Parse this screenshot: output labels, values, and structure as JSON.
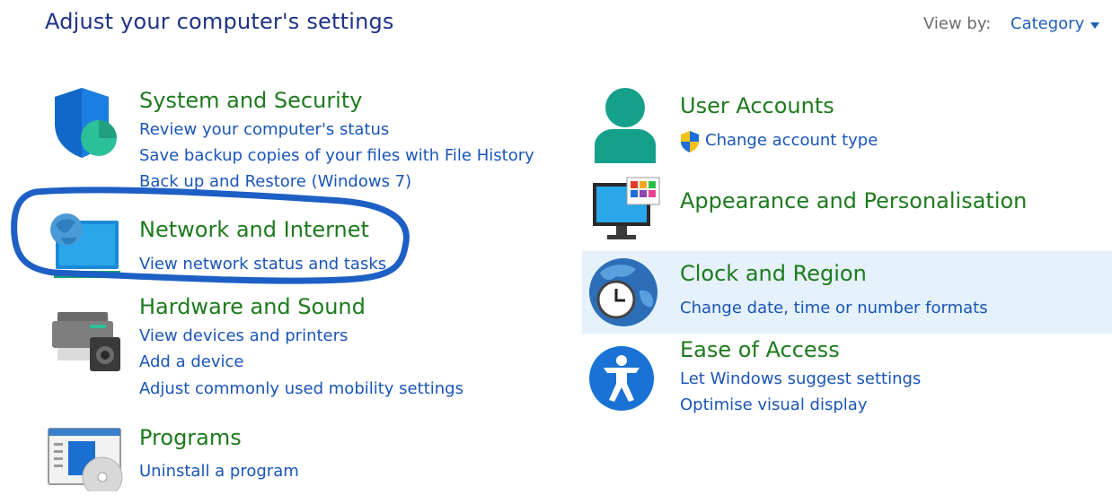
{
  "header": {
    "title": "Adjust your computer's settings",
    "view_by_label": "View by:",
    "view_by_value": "Category"
  },
  "categories": [
    {
      "title": "System and Security",
      "icon": "shield-icon",
      "links": [
        "Review your computer's status",
        "Save backup copies of your files with File History",
        "Back up and Restore (Windows 7)"
      ]
    },
    {
      "title": "Network and Internet",
      "icon": "globe-monitor-icon",
      "links": [
        "View network status and tasks"
      ]
    },
    {
      "title": "Hardware and Sound",
      "icon": "printer-speaker-icon",
      "links": [
        "View devices and printers",
        "Add a device",
        "Adjust commonly used mobility settings"
      ]
    },
    {
      "title": "Programs",
      "icon": "programs-disc-icon",
      "links": [
        "Uninstall a program"
      ]
    },
    {
      "title": "User Accounts",
      "icon": "user-icon",
      "links": [
        "Change account type"
      ]
    },
    {
      "title": "Appearance and Personalisation",
      "icon": "monitor-palette-icon",
      "links": []
    },
    {
      "title": "Clock and Region",
      "icon": "clock-globe-icon",
      "links": [
        "Change date, time or number formats"
      ]
    },
    {
      "title": "Ease of Access",
      "icon": "accessibility-icon",
      "links": [
        "Let Windows suggest settings",
        "Optimise visual display"
      ]
    }
  ],
  "colors": {
    "title_blue": "#1e3287",
    "category_green": "#1d7a1d",
    "link_blue": "#1955b8",
    "hover_bg": "#e5f1fb",
    "annotation_circle": "#1d5fc4"
  }
}
